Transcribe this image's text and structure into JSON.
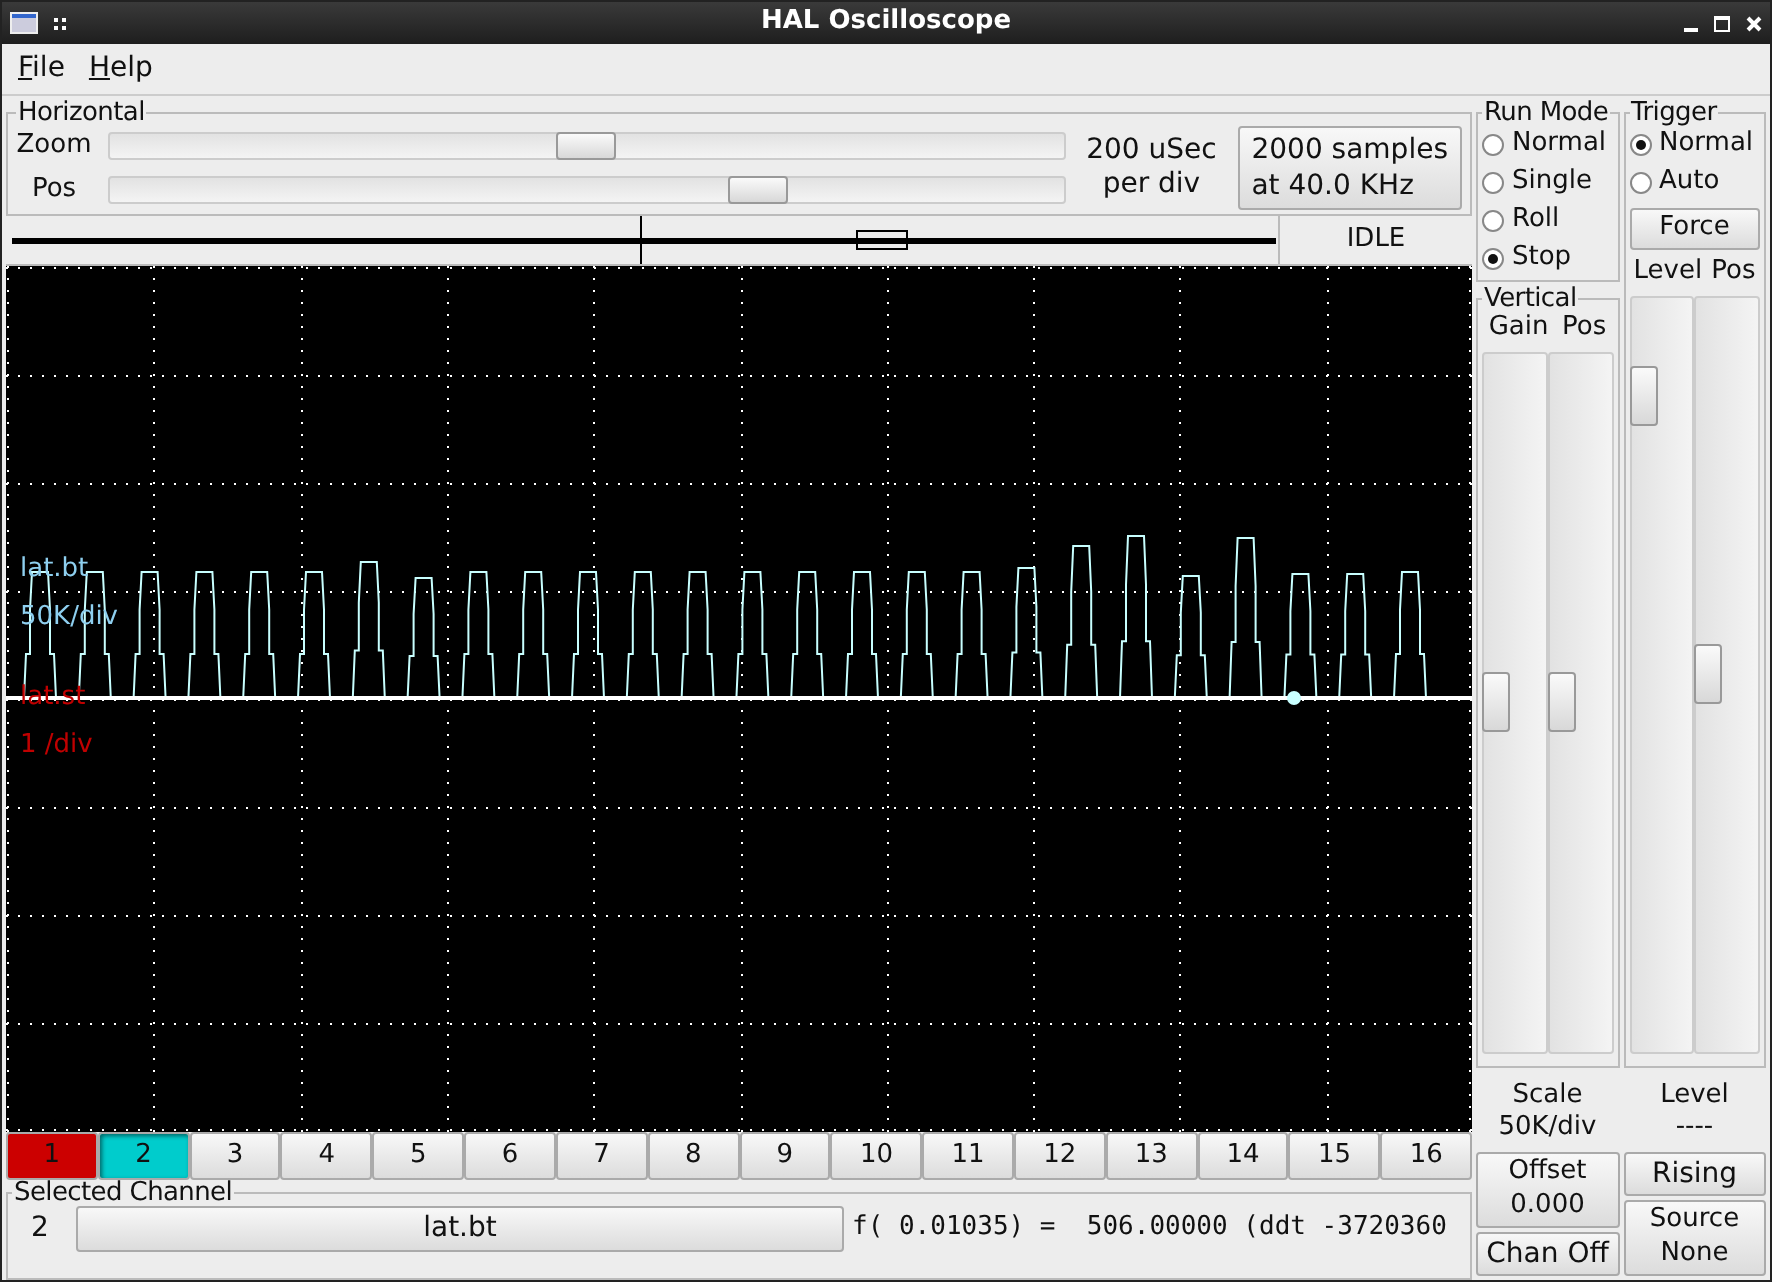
{
  "window": {
    "title": "HAL Oscilloscope"
  },
  "menu": [
    {
      "label": "File"
    },
    {
      "label": "Help"
    }
  ],
  "horizontal": {
    "title": "Horizontal",
    "zoom": {
      "label": "Zoom",
      "level": 0.5
    },
    "pos": {
      "label": "Pos",
      "level": 0.68
    },
    "scale": [
      "200 uSec",
      "per div"
    ],
    "samples_button": [
      "2000 samples",
      "at 40.0 KHz"
    ],
    "status": "IDLE"
  },
  "traces": [
    {
      "name": "lat.bt",
      "scale": "50K/div",
      "color": "#8ecfef"
    },
    {
      "name": "lat.st",
      "scale": "1 /div",
      "color": "#c00000"
    }
  ],
  "channels": [
    {
      "label": "1",
      "color": "#cc0000",
      "selected": false
    },
    {
      "label": "2",
      "color": "#00cccc",
      "selected": true
    },
    {
      "label": "3",
      "selected": false
    },
    {
      "label": "4",
      "selected": false
    },
    {
      "label": "5",
      "selected": false
    },
    {
      "label": "6",
      "selected": false
    },
    {
      "label": "7",
      "selected": false
    },
    {
      "label": "8",
      "selected": false
    },
    {
      "label": "9",
      "selected": false
    },
    {
      "label": "10",
      "selected": false
    },
    {
      "label": "11",
      "selected": false
    },
    {
      "label": "12",
      "selected": false
    },
    {
      "label": "13",
      "selected": false
    },
    {
      "label": "14",
      "selected": false
    },
    {
      "label": "15",
      "selected": false
    },
    {
      "label": "16",
      "selected": false
    }
  ],
  "selected_channel": {
    "title": "Selected Channel",
    "number": "2",
    "name": "lat.bt",
    "readout": "f( 0.01035) =  506.00000 (ddt -3720360"
  },
  "run_mode": {
    "title": "Run Mode",
    "options": [
      {
        "label": "Normal",
        "selected": false
      },
      {
        "label": "Single",
        "selected": false
      },
      {
        "label": "Roll",
        "selected": false
      },
      {
        "label": "Stop",
        "selected": true
      }
    ]
  },
  "vertical": {
    "title": "Vertical",
    "gain_label": "Gain",
    "pos_label": "Pos",
    "gain": {
      "level": 0.5
    },
    "pos": {
      "level": 0.5
    },
    "scale": [
      "Scale",
      "50K/div"
    ],
    "offset_button": [
      "Offset",
      "0.000"
    ],
    "chan_off_button": "Chan Off"
  },
  "trigger": {
    "title": "Trigger",
    "options": [
      {
        "label": "Normal",
        "selected": true
      },
      {
        "label": "Auto",
        "selected": false
      }
    ],
    "force_button": "Force",
    "level_label": "Level",
    "pos_label": "Pos",
    "level": {
      "level": 0.87
    },
    "pos": {
      "level": 0.5
    },
    "level_title": "Level",
    "level_value": "----",
    "edge_button": "Rising",
    "source_button": [
      "Source",
      "None"
    ]
  }
}
